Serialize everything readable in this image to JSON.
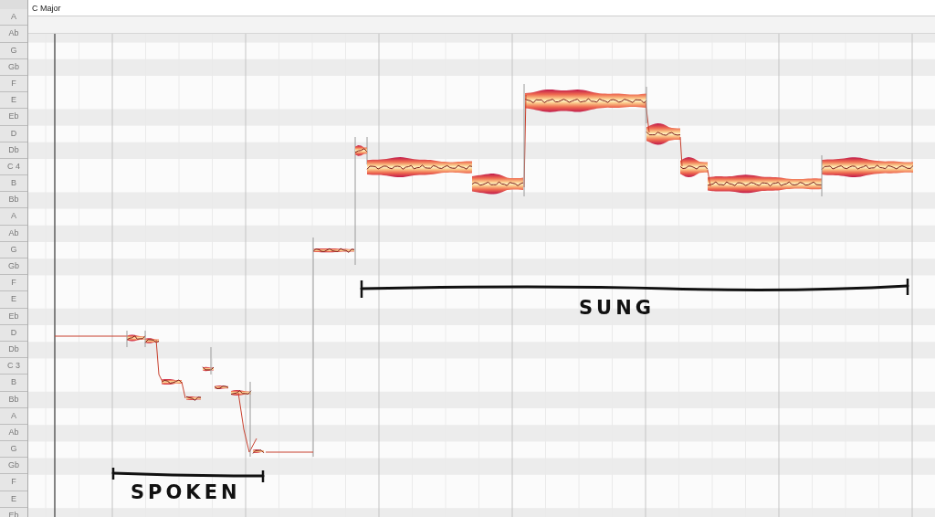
{
  "header": {
    "key": "C Major"
  },
  "keyboard": [
    {
      "label": "A",
      "kind": "white"
    },
    {
      "label": "Ab",
      "kind": "black"
    },
    {
      "label": "G",
      "kind": "white"
    },
    {
      "label": "Gb",
      "kind": "black"
    },
    {
      "label": "F",
      "kind": "white"
    },
    {
      "label": "E",
      "kind": "white"
    },
    {
      "label": "Eb",
      "kind": "black"
    },
    {
      "label": "D",
      "kind": "white"
    },
    {
      "label": "Db",
      "kind": "black"
    },
    {
      "label": "C 4",
      "kind": "white"
    },
    {
      "label": "B",
      "kind": "white"
    },
    {
      "label": "Bb",
      "kind": "black"
    },
    {
      "label": "A",
      "kind": "white"
    },
    {
      "label": "Ab",
      "kind": "black"
    },
    {
      "label": "G",
      "kind": "white"
    },
    {
      "label": "Gb",
      "kind": "black"
    },
    {
      "label": "F",
      "kind": "white"
    },
    {
      "label": "E",
      "kind": "white"
    },
    {
      "label": "Eb",
      "kind": "black"
    },
    {
      "label": "D",
      "kind": "white"
    },
    {
      "label": "Db",
      "kind": "black"
    },
    {
      "label": "C 3",
      "kind": "white"
    },
    {
      "label": "B",
      "kind": "white"
    },
    {
      "label": "Bb",
      "kind": "black"
    },
    {
      "label": "A",
      "kind": "white"
    },
    {
      "label": "Ab",
      "kind": "black"
    },
    {
      "label": "G",
      "kind": "white"
    },
    {
      "label": "Gb",
      "kind": "black"
    },
    {
      "label": "F",
      "kind": "white"
    },
    {
      "label": "E",
      "kind": "white"
    },
    {
      "label": "Eb",
      "kind": "black"
    }
  ],
  "annotations": [
    {
      "label": "SUNG"
    },
    {
      "label": "SPOKEN"
    }
  ]
}
